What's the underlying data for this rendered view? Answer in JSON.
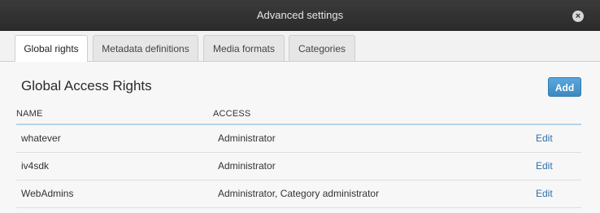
{
  "dialog": {
    "title": "Advanced settings",
    "close_icon": "close-icon"
  },
  "tabs": [
    {
      "label": "Global rights",
      "active": true
    },
    {
      "label": "Metadata definitions",
      "active": false
    },
    {
      "label": "Media formats",
      "active": false
    },
    {
      "label": "Categories",
      "active": false
    }
  ],
  "panel": {
    "heading": "Global Access Rights",
    "add_label": "Add"
  },
  "table": {
    "columns": [
      "NAME",
      "ACCESS"
    ],
    "rows": [
      {
        "name": "whatever",
        "access": "Administrator",
        "action": "Edit"
      },
      {
        "name": "iv4sdk",
        "access": "Administrator",
        "action": "Edit"
      },
      {
        "name": "WebAdmins",
        "access": "Administrator, Category administrator",
        "action": "Edit"
      }
    ]
  },
  "colors": {
    "accent": "#4a98d0",
    "header_rule": "#b3d4ea",
    "link": "#2f6fa8"
  }
}
